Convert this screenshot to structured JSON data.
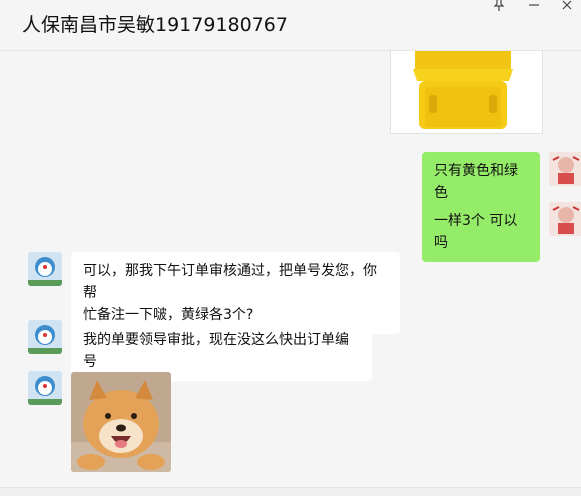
{
  "window": {
    "title": "人保南昌市吴敏19179180767",
    "controls": {
      "pin_icon": "pin-icon",
      "minimize": "—",
      "close": "×"
    }
  },
  "messages": [
    {
      "side": "right",
      "type": "image",
      "description_icon": "yellow-storage-box-image"
    },
    {
      "side": "right",
      "type": "text",
      "text": "只有黄色和绿色"
    },
    {
      "side": "right",
      "type": "text",
      "text": "一样3个 可以吗"
    },
    {
      "side": "left",
      "type": "text",
      "text_line1": "可以，那我下午订单审核通过，把单号发您，你帮",
      "text_line2": "忙备注一下啵，黄绿各3个?"
    },
    {
      "side": "left",
      "type": "text",
      "text": "我的单要领导审批，现在没这么快出订单编号"
    },
    {
      "side": "left",
      "type": "image",
      "description_icon": "shiba-dog-sticker"
    }
  ],
  "colors": {
    "right_bubble": "#95ec69",
    "left_bubble": "#ffffff",
    "background": "#f5f5f5"
  }
}
